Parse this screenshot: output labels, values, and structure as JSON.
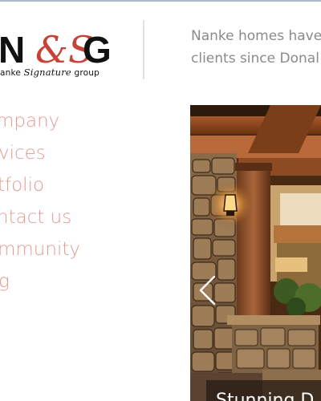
{
  "logo": {
    "letters": [
      "N",
      "G"
    ],
    "script_letters": "&S",
    "tagline_start": "anke",
    "tagline_script": "Signature",
    "tagline_end": "group",
    "accent_color": "#c6433a"
  },
  "intro": {
    "lines": [
      "Nanke homes have",
      "clients since Donal"
    ]
  },
  "nav": {
    "items": [
      {
        "label": "mpany"
      },
      {
        "label": "vices"
      },
      {
        "label": "tfolio"
      },
      {
        "label": "ntact us"
      },
      {
        "label": "mmunity"
      },
      {
        "label": "g"
      }
    ],
    "color": "#e39b92"
  },
  "slider": {
    "caption": "Stunning D",
    "prev_icon": "chevron-left-icon"
  }
}
